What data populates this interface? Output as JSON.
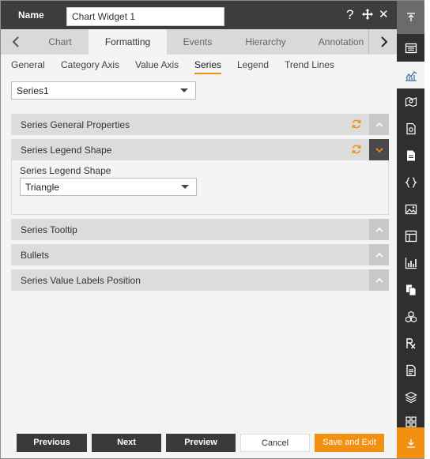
{
  "header": {
    "name_label": "Name",
    "name_value": "Chart Widget 1",
    "help_icon": "?",
    "close_icon": "✕"
  },
  "tabs": {
    "items": [
      {
        "label": "Chart"
      },
      {
        "label": "Formatting"
      },
      {
        "label": "Events"
      },
      {
        "label": "Hierarchy"
      },
      {
        "label": "Annotation"
      }
    ],
    "active": "Formatting"
  },
  "subtabs": {
    "items": [
      {
        "label": "General"
      },
      {
        "label": "Category Axis"
      },
      {
        "label": "Value Axis"
      },
      {
        "label": "Series"
      },
      {
        "label": "Legend"
      },
      {
        "label": "Trend Lines"
      }
    ],
    "active": "Series"
  },
  "series_select": {
    "value": "Series1"
  },
  "accordions": [
    {
      "title": "Series General Properties",
      "expanded": false,
      "has_refresh": true
    },
    {
      "title": "Series Legend Shape",
      "expanded": true,
      "has_refresh": true
    },
    {
      "title": "Series Tooltip",
      "expanded": false,
      "has_refresh": false
    },
    {
      "title": "Bullets",
      "expanded": false,
      "has_refresh": false
    },
    {
      "title": "Series Value Labels Position",
      "expanded": false,
      "has_refresh": false
    }
  ],
  "legend_shape": {
    "label": "Series Legend Shape",
    "value": "Triangle"
  },
  "footer": {
    "previous": "Previous",
    "next": "Next",
    "preview": "Preview",
    "cancel": "Cancel",
    "save_exit": "Save and Exit"
  },
  "colors": {
    "accent": "#f29111",
    "header_bg": "#3d3d3d",
    "sidebar_bg": "#2f2f2f"
  },
  "sidebar": {
    "icons": [
      "collapse-up-icon",
      "dashboard-icon",
      "chart-icon",
      "map-icon",
      "document-settings-icon",
      "document-icon",
      "code-braces-icon",
      "image-icon",
      "layout-icon",
      "bar-chart-icon",
      "copy-icon",
      "cubes-icon",
      "rx-icon",
      "report-icon",
      "layers-icon",
      "grid-icon",
      "download-icon"
    ]
  }
}
